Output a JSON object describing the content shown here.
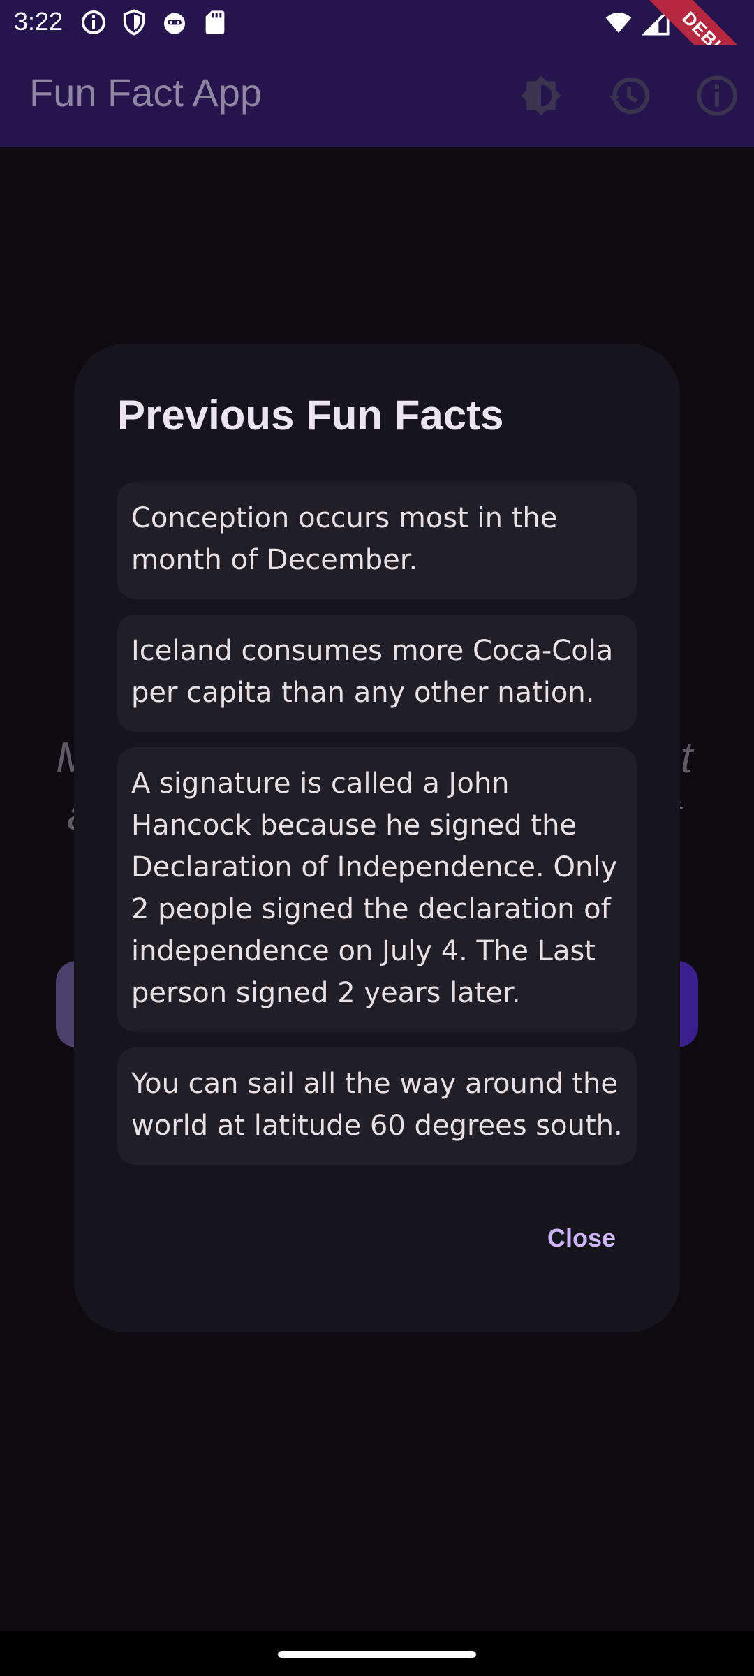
{
  "status_bar": {
    "time": "3:22",
    "icons": [
      "info-icon",
      "shield-icon",
      "face-icon",
      "sd-card-icon",
      "wifi-icon",
      "signal-icon"
    ],
    "debug_label": "DEBUG"
  },
  "app_bar": {
    "title": "Fun Fact App",
    "actions": [
      "brightness-icon",
      "history-icon",
      "info-icon"
    ],
    "colors": {
      "background": "#25154d",
      "title": "#8e86a3"
    }
  },
  "background": {
    "left_fragment": "M",
    "left_fragment_2": "a",
    "right_fragment": "t",
    "right_fragment_2": "t"
  },
  "dialog": {
    "title": "Previous Fun Facts",
    "facts": [
      "Conception occurs most in the month of December.",
      "Iceland consumes more Coca-Cola per capita than any other nation.",
      "A signature is called a John Hancock because he signed the Declaration of Independence. Only 2 people signed the declaration of independence on July 4. The Last person signed 2 years later.",
      "You can sail all the way around the world at latitude 60 degrees south."
    ],
    "close_label": "Close",
    "colors": {
      "background": "#17151c",
      "card": "#211f26",
      "accent": "#cdb6ff"
    }
  }
}
